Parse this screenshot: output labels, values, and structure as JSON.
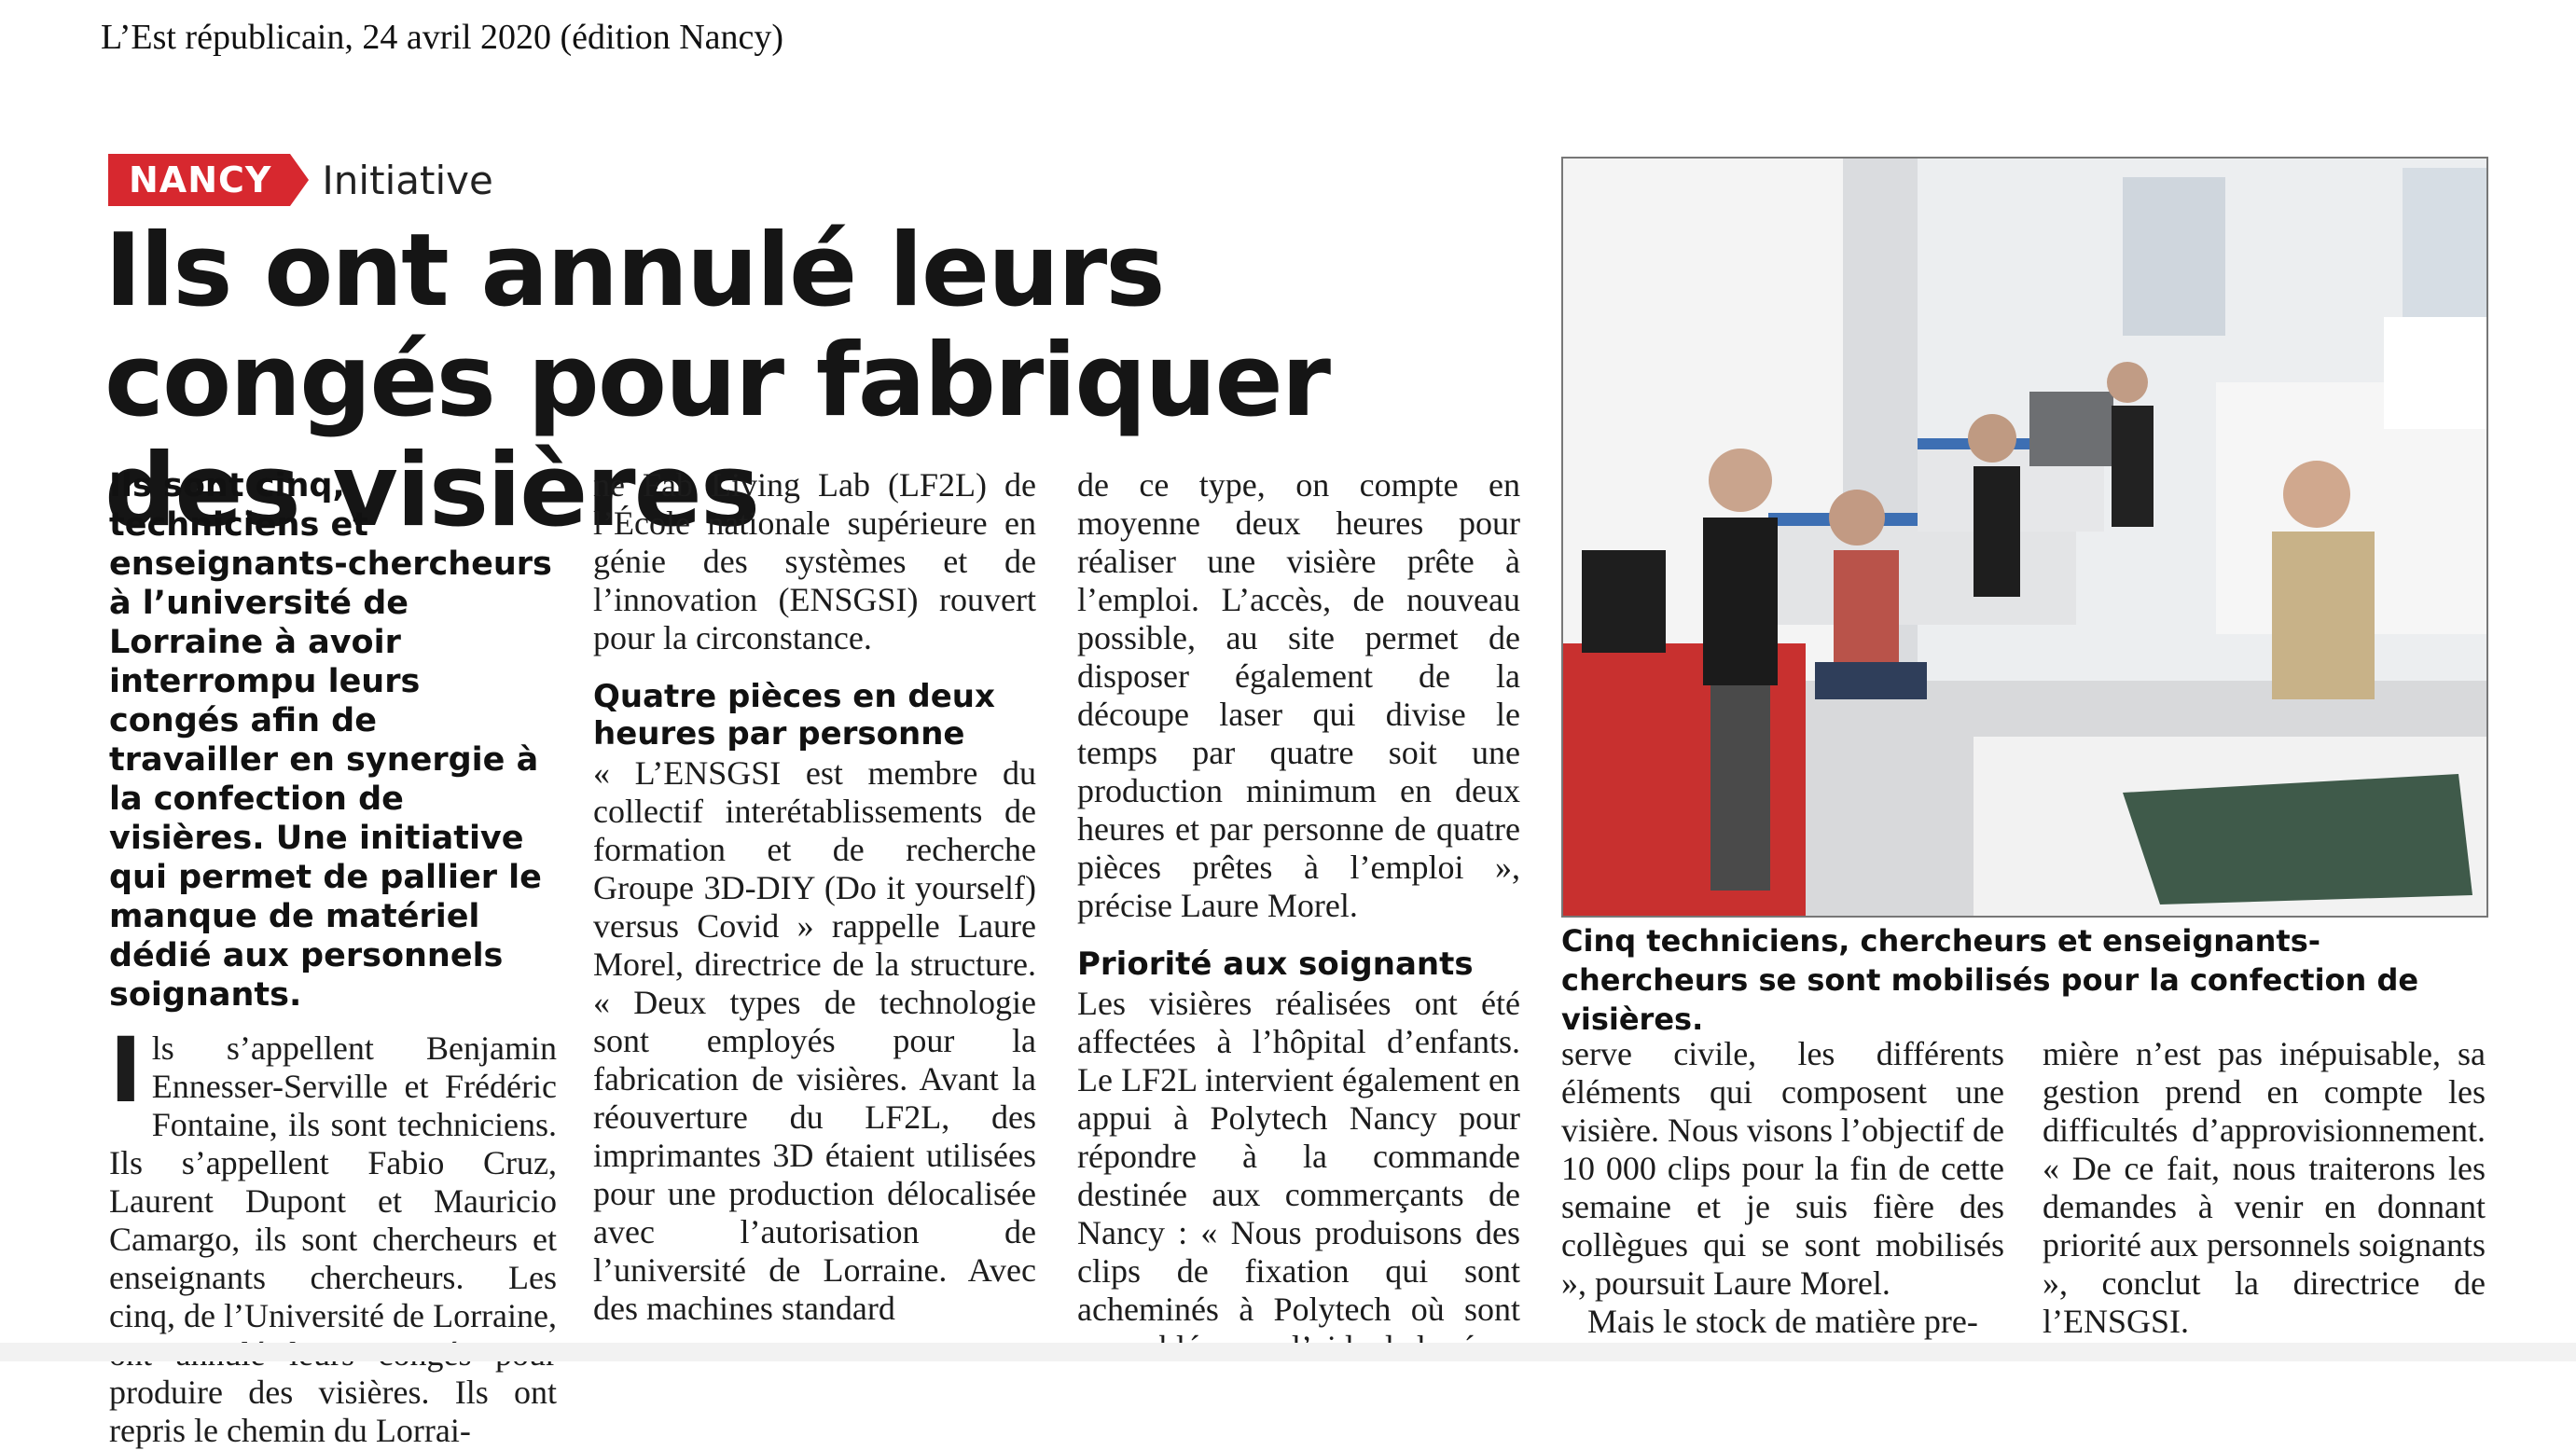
{
  "source": "L’Est républicain, 24 avril 2020 (édition Nancy)",
  "kicker": {
    "tag": "NANCY",
    "rubric": "Initiative"
  },
  "headline": "Ils ont annulé leurs congés pour fabriquer des visières",
  "chapo": "Ils sont cinq, techniciens et enseignants-chercheurs à l’université de Lorraine à avoir interrompu leurs congés afin de travailler en synergie à la confection de visières. Une initiative qui permet de pallier le manque de matériel dédié aux personnels soignants.",
  "body": {
    "col1": {
      "dropcap": "I",
      "text": "ls s’appellent Benjamin Ennesser-Serville et Frédéric Fontaine, ils sont techniciens. Ils s’appellent Fabio Cruz, Laurent Dupont et Mauricio Camargo, ils sont chercheurs et enseignants chercheurs. Les cinq, de l’Université de Lorraine, ont annulé leurs congés pour produire des visières. Ils ont repris le chemin du Lorrai-"
    },
    "col2": {
      "p1": "ne Fab Living Lab (LF2L) de l’École nationale supérieure en génie des systèmes et de l’innovation (ENSGSI) rouvert pour la circonstance.",
      "subhead": "Quatre pièces en deux heures par personne",
      "p2": "« L’ENSGSI est membre du collectif interétablissements de formation et de recherche Groupe 3D-DIY (Do it yourself) versus Covid » rappelle Laure Morel, directrice de la structure. « Deux types de technologie sont employés pour la fabrication de visières. Avant la réouverture du LF2L, des imprimantes 3D étaient utilisées pour une production délocalisée avec l’autorisation de l’université de Lorraine. Avec des machines standard"
    },
    "col3": {
      "p1": "de ce type, on compte en moyenne deux heures pour réaliser une visière prête à l’emploi. L’accès, de nouveau possible, au site permet de disposer également de la découpe laser qui divise le temps par quatre soit une production minimum en deux heures et par personne de quatre pièces prêtes à l’emploi », précise Laure Morel.",
      "subhead": "Priorité aux soignants",
      "p2": "Les visières réalisées ont été affectées à l’hôpital d’enfants. Le LF2L intervient également en appui à Polytech Nancy pour répondre à la commande destinée aux commerçants de Nancy : « Nous produisons des clips de fixation qui sont acheminés à Polytech où sont assemblés avec l’aide de la ré-"
    },
    "col4": {
      "p1": "serve civile, les différents éléments qui composent une visière. Nous visons l’objectif de 10 000 clips pour la fin de cette semaine et je suis fière des collègues qui se sont mobilisés », poursuit Laure Morel.",
      "p2": "Mais le stock de matière pre-"
    },
    "col5": {
      "p1": "mière n’est pas inépuisable, sa gestion prend en compte les difficultés d’approvisionnement. « De ce fait, nous traiterons les demandes à venir en donnant priorité aux personnels soignants », conclut la directrice de l’ENSGSI."
    }
  },
  "photo": {
    "caption": "Cinq techniciens, chercheurs et enseignants-chercheurs se sont mobilisés pour la confection de visières.",
    "colors": {
      "wall": "#eeeff1",
      "floor": "#d9dadc",
      "accent_red": "#c8302f",
      "machine_blue": "#3d6fb3"
    }
  },
  "colors": {
    "kicker_red": "#d7282f",
    "text": "#1a1a1a"
  }
}
